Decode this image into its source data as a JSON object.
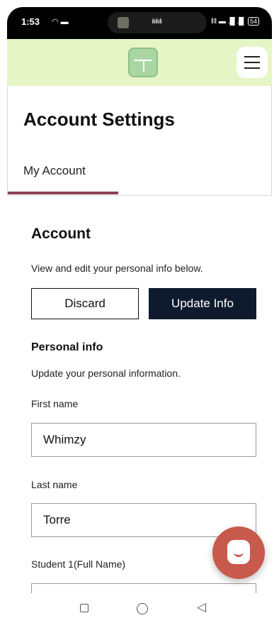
{
  "status_bar": {
    "time": "1:53",
    "left_icons": "◠ ▬",
    "right_icons": "‖‖ ▬ .█ .█",
    "battery": "54"
  },
  "header": {
    "logo_icon": "app-logo-icon",
    "menu_icon": "hamburger-menu-icon"
  },
  "settings": {
    "title": "Account Settings",
    "tabs": [
      {
        "label": "My Account",
        "active": true
      }
    ],
    "accent_color": "#8d4154"
  },
  "account": {
    "heading": "Account",
    "description": "View and edit your personal info below.",
    "discard_label": "Discard",
    "update_label": "Update Info"
  },
  "personal_info": {
    "heading": "Personal info",
    "description": "Update your personal information.",
    "fields": [
      {
        "label": "First name",
        "value": "Whimzy"
      },
      {
        "label": "Last name",
        "value": "Torre"
      },
      {
        "label": "Student 1(Full Name)",
        "value": ""
      }
    ]
  },
  "chat_widget": {
    "icon": "chat-icon",
    "color": "#c85a4d"
  },
  "colors": {
    "header_bg": "#e6f5c6",
    "primary_button": "#0e1b2e"
  }
}
